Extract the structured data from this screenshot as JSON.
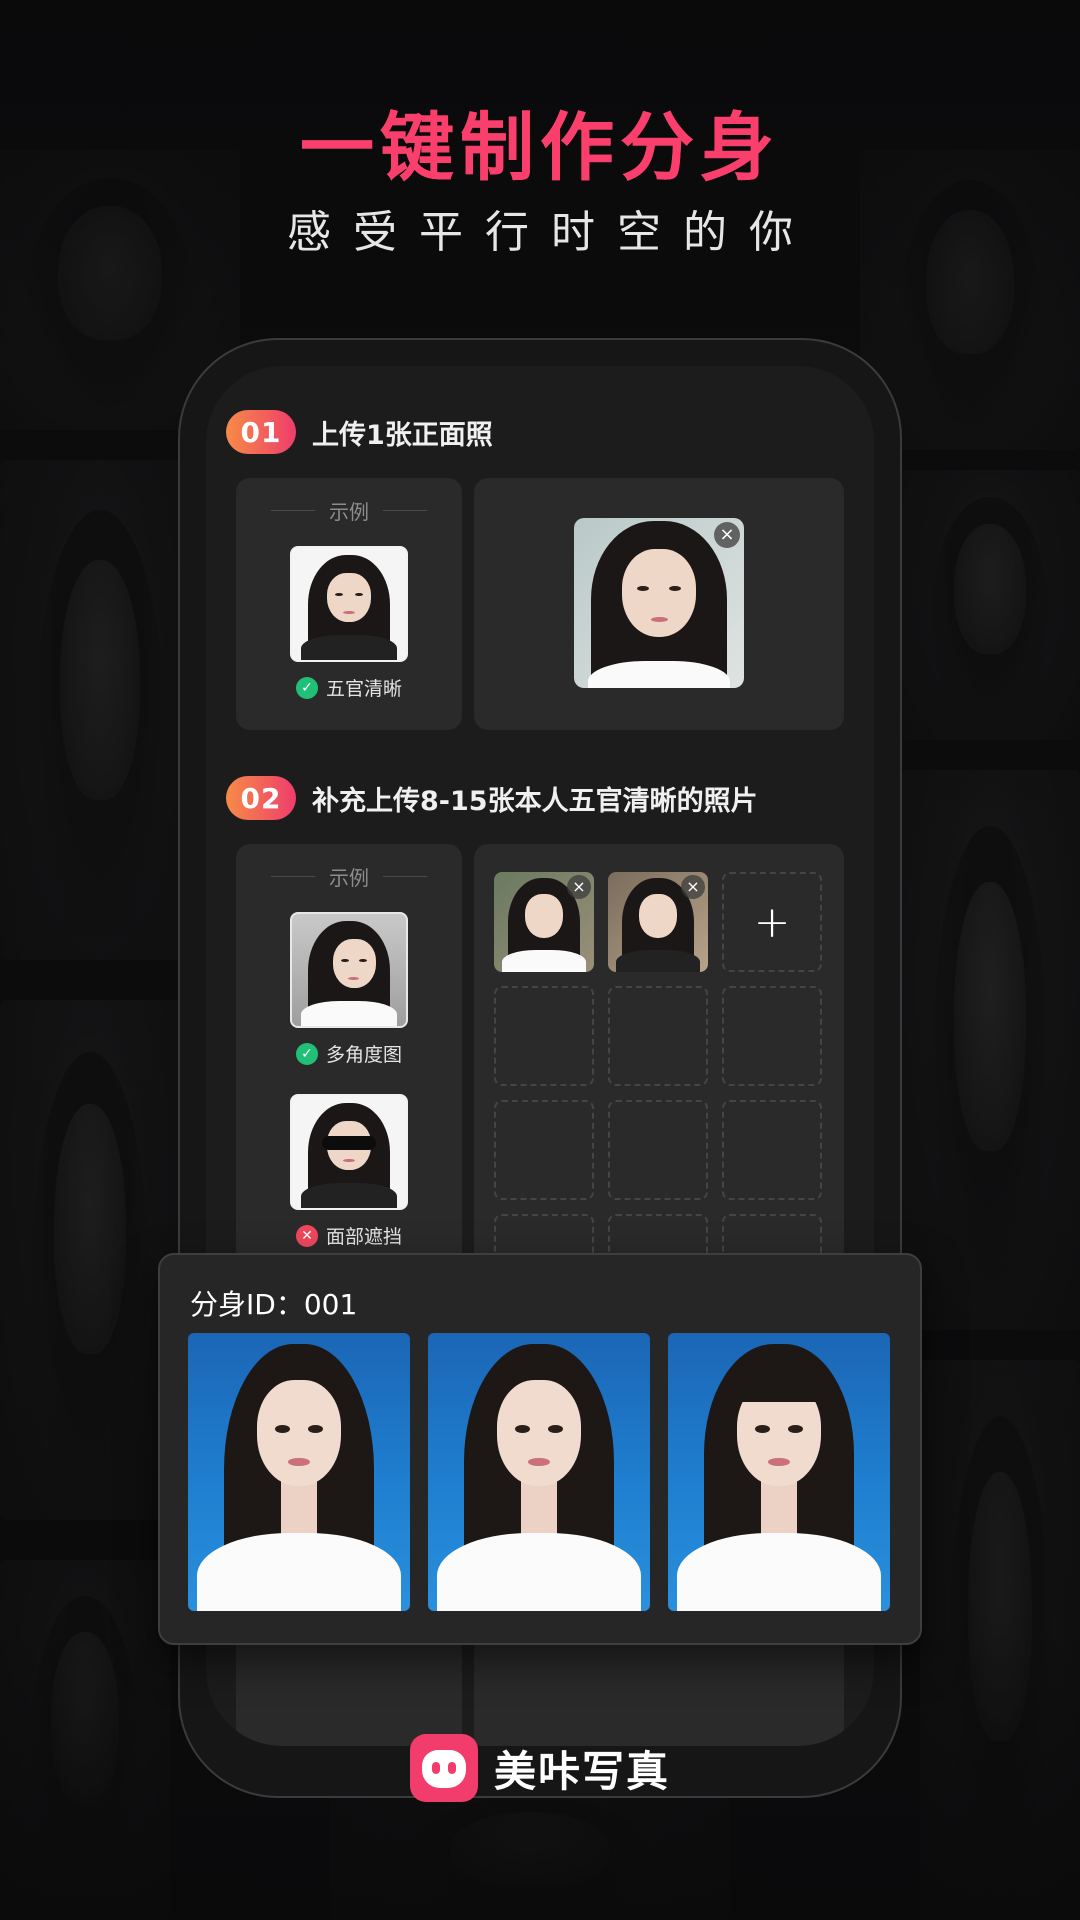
{
  "header": {
    "title": "一键制作分身",
    "subtitle": "感受平行时空的你"
  },
  "step1": {
    "number": "01",
    "title": "上传1张正面照",
    "example_label": "示例",
    "example_tag": "五官清晰",
    "close_glyph": "×"
  },
  "step2": {
    "number": "02",
    "title": "补充上传8-15张本人五官清晰的照片",
    "example_label": "示例",
    "good_tag": "多角度图",
    "bad_tag": "面部遮挡",
    "add_glyph": "+",
    "close_glyph": "×"
  },
  "result": {
    "id_label": "分身ID：001"
  },
  "brand": {
    "name": "美咔写真",
    "accent_color": "#f23d6c"
  },
  "colors": {
    "headline": "#fb3f6c",
    "badge_gradient_start": "#f78b47",
    "badge_gradient_end": "#ee3d6b",
    "ok": "#21c078",
    "bad": "#f0485d"
  }
}
